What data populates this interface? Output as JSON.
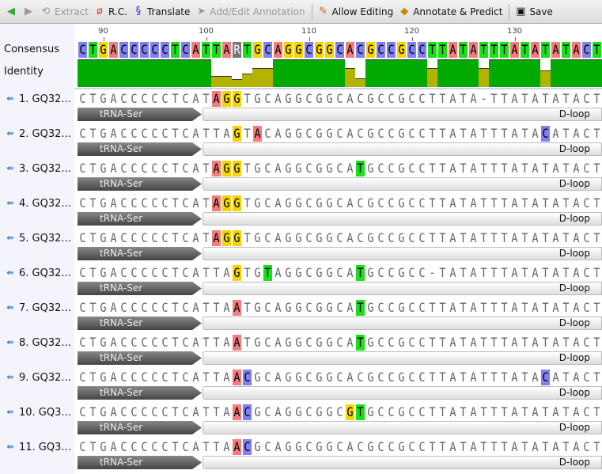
{
  "toolbar": {
    "back": "back-arrow",
    "forward": "forward-arrow",
    "extract": "Extract",
    "rc": "R.C.",
    "translate": "Translate",
    "add_annotation": "Add/Edit Annotation",
    "allow_editing": "Allow Editing",
    "annotate_predict": "Annotate & Predict",
    "save": "Save"
  },
  "labels": {
    "consensus": "Consensus",
    "identity": "Identity"
  },
  "ruler": [
    {
      "pos": 90,
      "label": "90"
    },
    {
      "pos": 100,
      "label": "100"
    },
    {
      "pos": 110,
      "label": "110"
    },
    {
      "pos": 120,
      "label": "120"
    },
    {
      "pos": 130,
      "label": "130"
    }
  ],
  "ruler_start": 88,
  "consensus": "CTGACCCCCTCATTARTGCAGGCGGCACGCCGCCTTATATTTATATATACT",
  "colors": {
    "A": "#f47c7c",
    "C": "#8080f0",
    "G": "#f5d400",
    "T": "#19e019",
    "R": "#777777",
    "identity_full": "#00aa00",
    "identity_partial": "#b3b300"
  },
  "annotations": {
    "left": "tRNA-Ser",
    "right": "D-loop"
  },
  "rows": [
    {
      "name": "1. GQ32...",
      "seq": "CTGACCCCCTCATAGGTGCAGGCGGCACGCCGCCTTATA-TTATATATACT"
    },
    {
      "name": "2. GQ32...",
      "seq": "CTGACCCCCTCATTAGTACAGGCGGCACGCCGCCTTATATTTATACATACT"
    },
    {
      "name": "3. GQ32...",
      "seq": "CTGACCCCCTCATAGGTGCAGGCGGCATGCCGCCTTATATTTATATATACT"
    },
    {
      "name": "4. GQ32...",
      "seq": "CTGACCCCCTCATAGGTGCAGGCGGCACGCCGCCTTATATTTATATATACT"
    },
    {
      "name": "5. GQ32...",
      "seq": "CTGACCCCCTCATAGGTGCAGGCGGCACGCCGCCTTATATTTATATATACT"
    },
    {
      "name": "6. GQ32...",
      "seq": "CTGACCCCCTCATTAGTGTAGGCGGCATGCCGCC-TATATTTATATATACT"
    },
    {
      "name": "7. GQ32...",
      "seq": "CTGACCCCCTCATTAATGCAGGCGGCATGCCGCCTTATATTTATATATACT"
    },
    {
      "name": "8. GQ32...",
      "seq": "CTGACCCCCTCATTAATGCAGGCGGCATGCCGCCTTATATTTATATATACT"
    },
    {
      "name": "9. GQ32...",
      "seq": "CTGACCCCCTCATTAACGCAGGCGGCACGCCGCCTTATATTTATACATACT"
    },
    {
      "name": "10. GQ3...",
      "seq": "CTGACCCCCTCATTAACGCAGGCGGCGTGCCGCCTTATATTTATATATACT"
    },
    {
      "name": "11. GQ3...",
      "seq": "CTGACCCCCTCATTAACGCAGGCGGCACGCCGCCTTATATTTATATATACT"
    }
  ]
}
